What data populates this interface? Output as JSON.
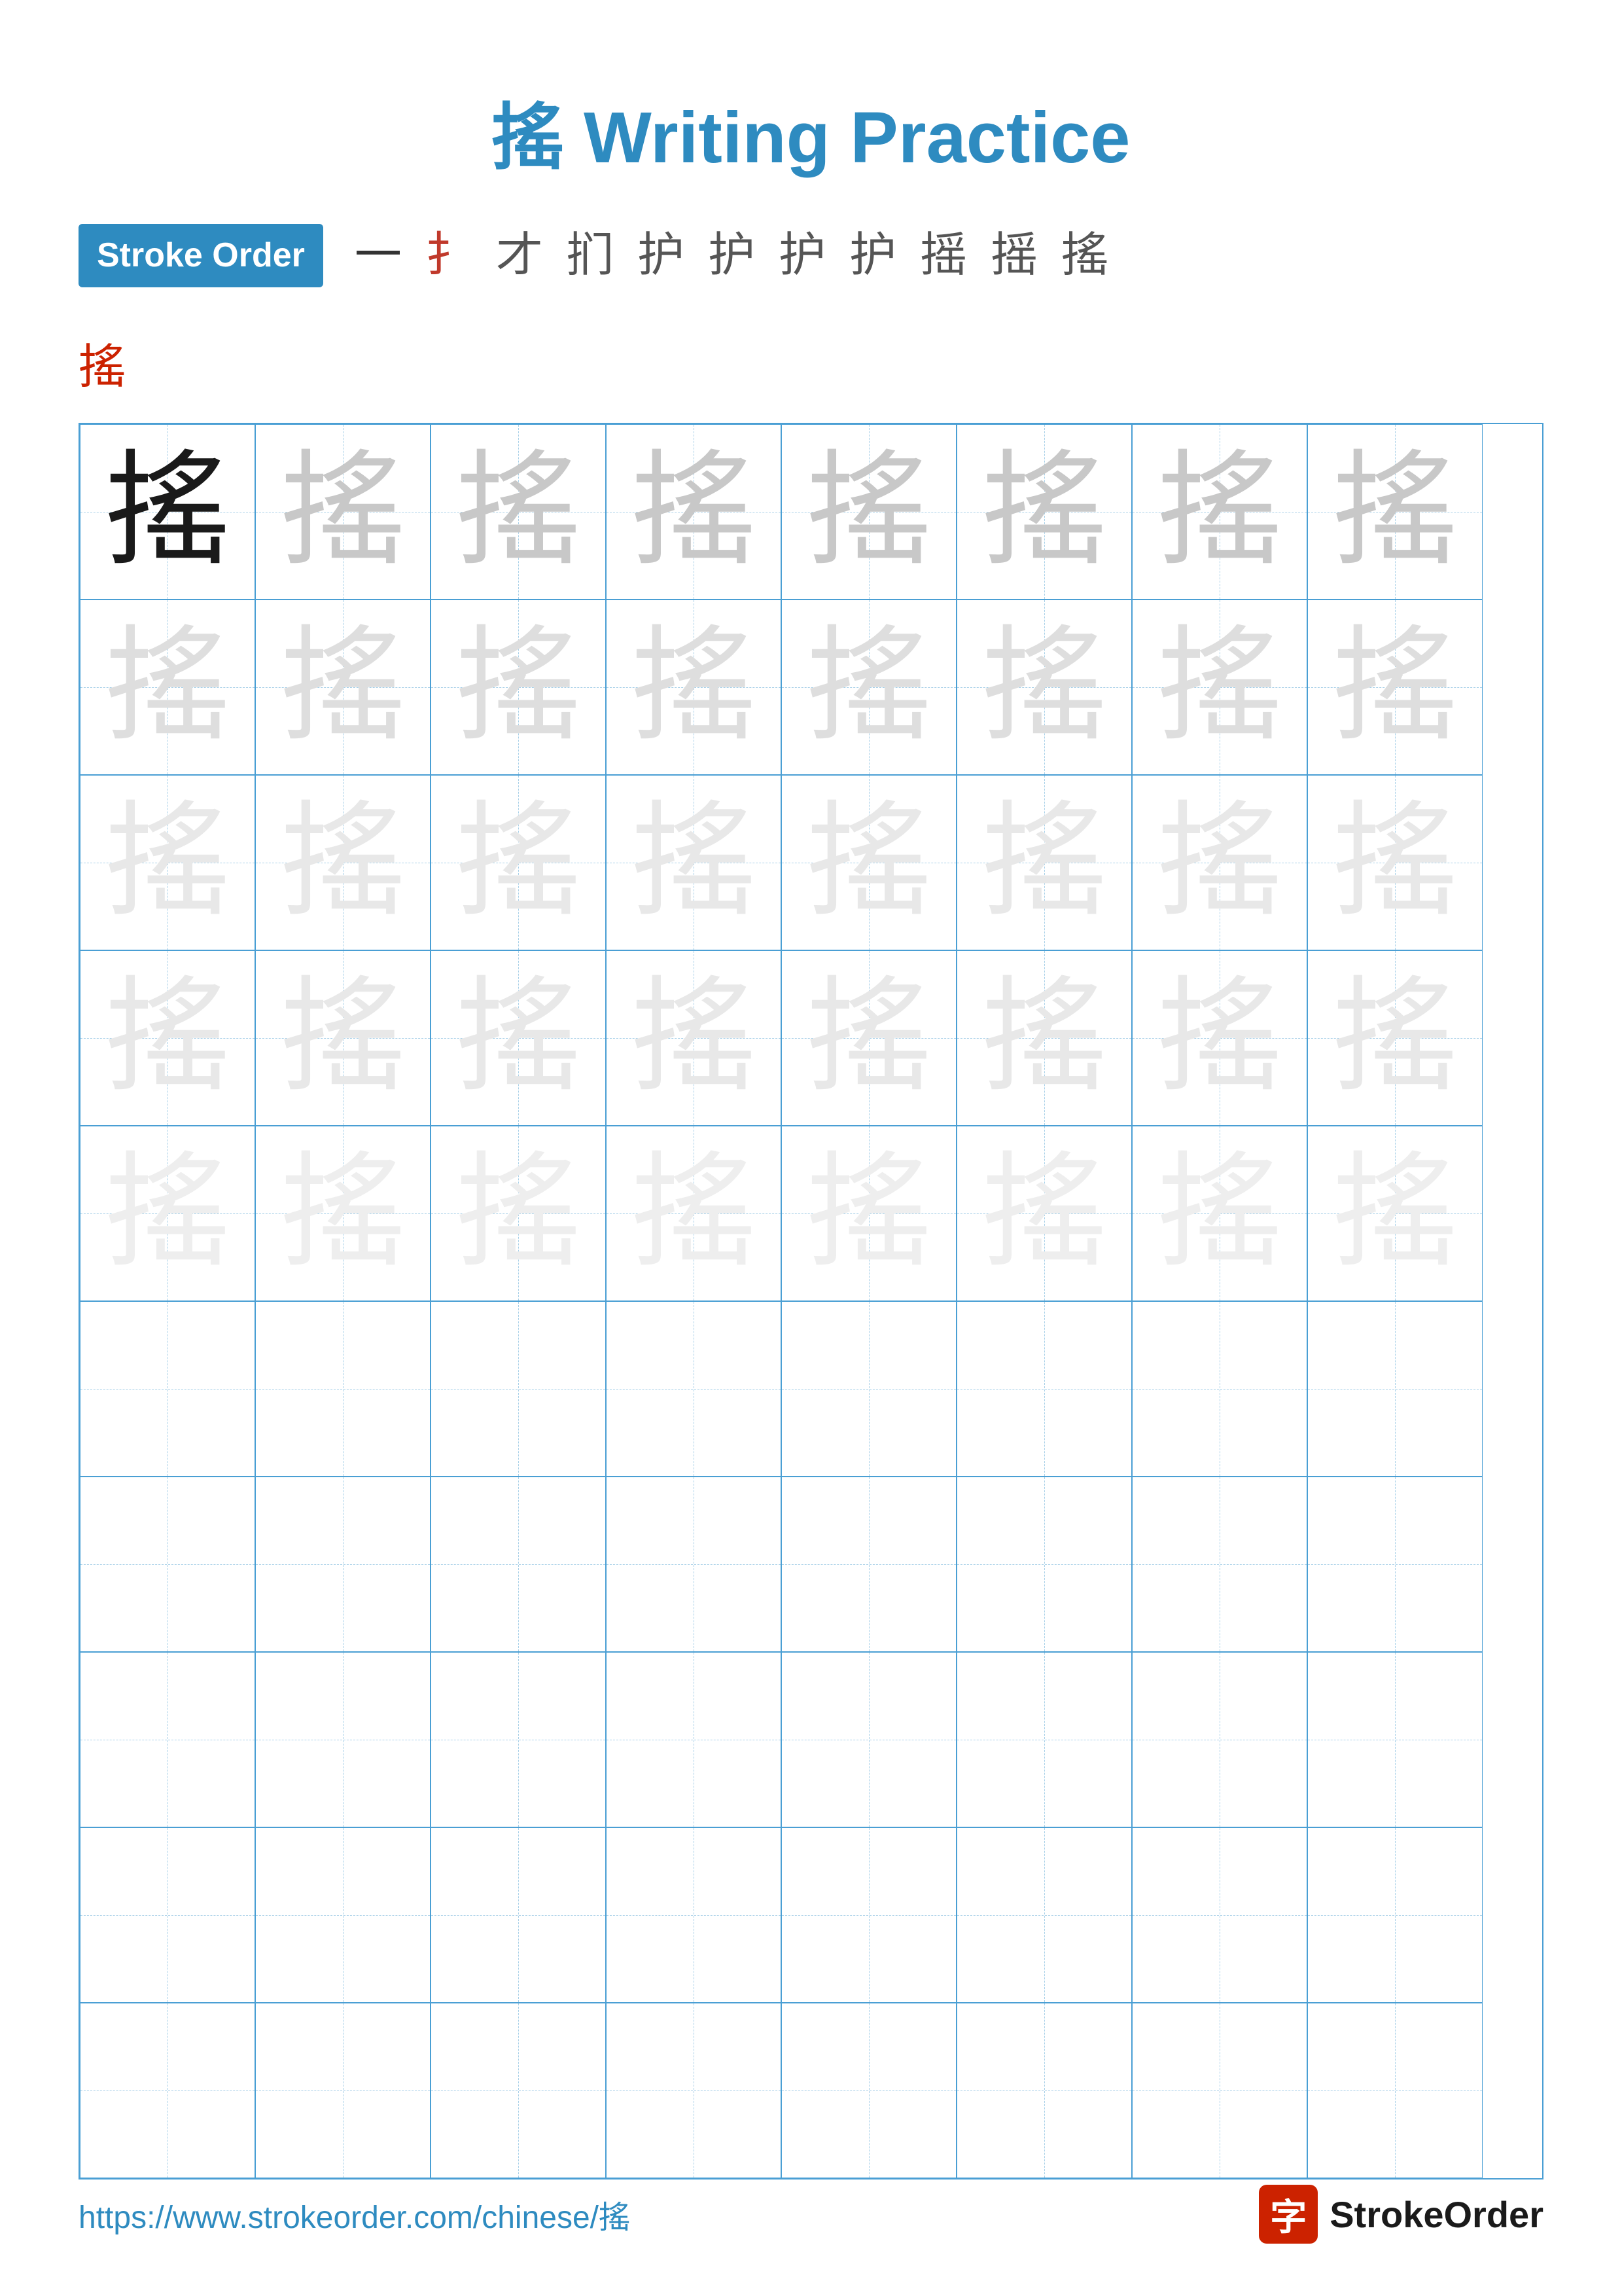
{
  "title": {
    "text": "搖 Writing Practice",
    "color": "#2e8bc0"
  },
  "stroke_order": {
    "badge_label": "Stroke Order",
    "chars": [
      "一",
      "扌",
      "才",
      "扪",
      "护",
      "护",
      "护",
      "护",
      "摇",
      "摇",
      "搖"
    ],
    "last_char": "搖"
  },
  "grid": {
    "character": "搖",
    "rows": 10,
    "cols": 8
  },
  "footer": {
    "url": "https://www.strokeorder.com/chinese/搖",
    "logo_char": "字",
    "logo_name": "StrokeOrder"
  }
}
